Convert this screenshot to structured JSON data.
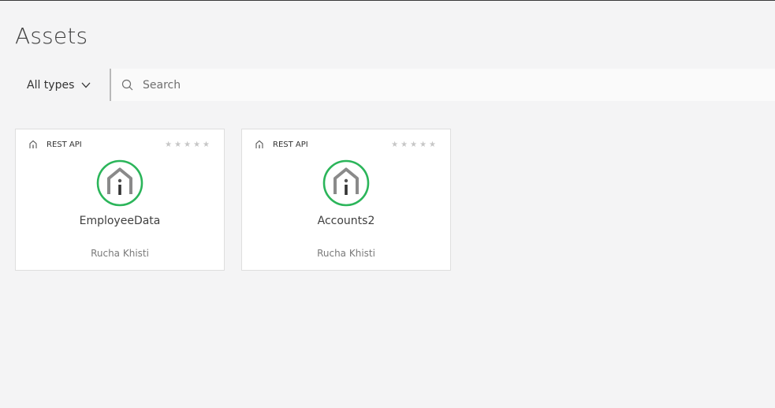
{
  "page": {
    "title": "Assets"
  },
  "filter": {
    "type_label": "All types",
    "search_placeholder": "Search",
    "search_value": ""
  },
  "assets": [
    {
      "type": "REST API",
      "name": "EmployeeData",
      "owner": "Rucha Khisti",
      "rating": 0,
      "max_rating": 5
    },
    {
      "type": "REST API",
      "name": "Accounts2",
      "owner": "Rucha Khisti",
      "rating": 0,
      "max_rating": 5
    }
  ],
  "icons": {
    "type_icon": "api-house-icon",
    "logo": "api-logo-icon",
    "dropdown": "chevron-down-icon",
    "search": "search-icon",
    "star": "star-icon"
  },
  "colors": {
    "logo_ring": "#2bb55a",
    "logo_glyph": "#8a8a8a",
    "star_empty": "#c6c6c6",
    "background": "#f4f4f5"
  }
}
